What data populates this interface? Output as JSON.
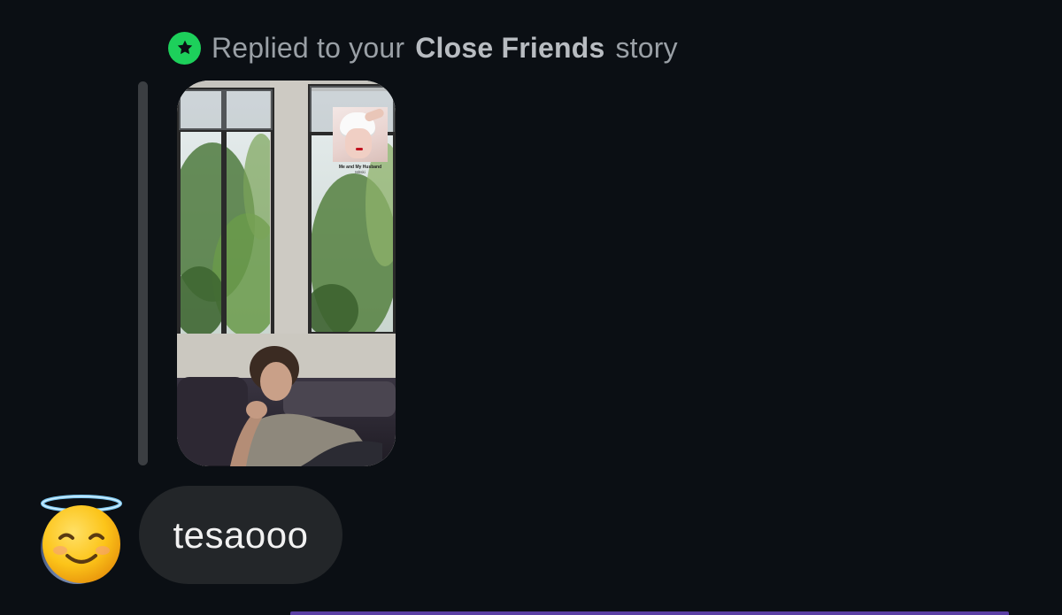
{
  "reply": {
    "prefix": "Replied to your",
    "highlight": "Close Friends",
    "suffix": "story",
    "badge_color": "#1dd05b",
    "badge_icon": "star-icon"
  },
  "story": {
    "music_sticker": {
      "title": "Me and My Husband",
      "artist": "Mitski"
    }
  },
  "message": {
    "avatar_icon": "smiling-face-with-halo",
    "text": "tesaooo"
  },
  "colors": {
    "background": "#0b0f14",
    "bubble": "#232629",
    "quote_bar": "#3b3e42"
  }
}
